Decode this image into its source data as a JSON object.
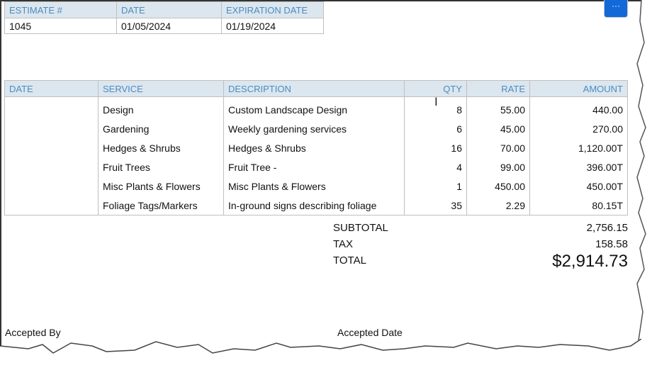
{
  "header_table": {
    "columns": [
      "ESTIMATE #",
      "DATE",
      "EXPIRATION DATE"
    ],
    "values": [
      "1045",
      "01/05/2024",
      "01/19/2024"
    ]
  },
  "more_button": {
    "label": "···",
    "icon": "ellipsis-icon"
  },
  "items_table": {
    "columns": [
      "DATE",
      "SERVICE",
      "DESCRIPTION",
      "QTY",
      "RATE",
      "AMOUNT"
    ],
    "rows": [
      {
        "date": "",
        "service": "Design",
        "description": "Custom Landscape Design",
        "qty": "8",
        "rate": "55.00",
        "amount": "440.00"
      },
      {
        "date": "",
        "service": "Gardening",
        "description": "Weekly gardening services",
        "qty": "6",
        "rate": "45.00",
        "amount": "270.00"
      },
      {
        "date": "",
        "service": "Hedges & Shrubs",
        "description": "Hedges & Shrubs",
        "qty": "16",
        "rate": "70.00",
        "amount": "1,120.00T"
      },
      {
        "date": "",
        "service": "Fruit Trees",
        "description": "Fruit Tree -",
        "qty": "4",
        "rate": "99.00",
        "amount": "396.00T"
      },
      {
        "date": "",
        "service": "Misc Plants & Flowers",
        "description": "Misc Plants & Flowers",
        "qty": "1",
        "rate": "450.00",
        "amount": "450.00T"
      },
      {
        "date": "",
        "service": "Foliage Tags/Markers",
        "description": "In-ground signs describing foliage",
        "qty": "35",
        "rate": "2.29",
        "amount": "80.15T"
      }
    ]
  },
  "totals": {
    "subtotal_label": "SUBTOTAL",
    "subtotal": "2,756.15",
    "tax_label": "TAX",
    "tax": "158.58",
    "total_label": "TOTAL",
    "total": "$2,914.73"
  },
  "footer": {
    "accepted_by": "Accepted By",
    "accepted_date": "Accepted Date"
  }
}
